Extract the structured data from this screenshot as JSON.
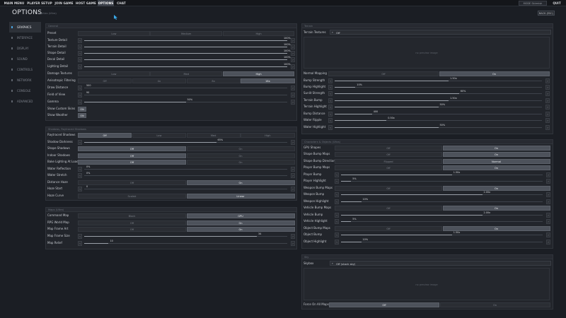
{
  "nav": {
    "items": [
      "MAIN MENU",
      "PLAYER SETUP",
      "JOIN GAME",
      "HOST GAME",
      "OPTIONS",
      "CHAT"
    ],
    "active": "OPTIONS",
    "mode": "MODE  Skirmish",
    "quit": "QUIT"
  },
  "header": {
    "title": "OPTIONS",
    "subtitle": "Graphics (Ultra)",
    "back": "BACK (ESC)"
  },
  "sidebar": {
    "items": [
      "GRAPHICS",
      "INTERFACE",
      "DISPLAY",
      "SOUND",
      "CONTROLS",
      "NETWORK",
      "CONSOLE",
      "ADVANCED"
    ],
    "active": "GRAPHICS"
  },
  "panels": {
    "general": "General",
    "shadows": "Shadows, Raytraced Shadows",
    "maps": "Maps (Ultra)",
    "terrain": "Terrain",
    "bumpmaps": "Characters & Objects (Ultra)",
    "sky": "Sky"
  },
  "general": {
    "preset": {
      "label": "Preset",
      "options": [
        "Low",
        "Medium",
        "High"
      ],
      "selected": -1
    },
    "texture_detail": {
      "label": "Texture Detail",
      "value": "100%",
      "level": 1.0
    },
    "terrain_detail": {
      "label": "Terrain Detail",
      "value": "100%",
      "level": 1.0
    },
    "shape_detail": {
      "label": "Shape Detail",
      "value": "100%",
      "level": 1.0
    },
    "decal_detail": {
      "label": "Decal Detail",
      "value": "100%",
      "level": 1.0
    },
    "lighting_detail": {
      "label": "Lighting Detail",
      "value": "100%",
      "level": 1.0
    },
    "damage_textures": {
      "label": "Damage Textures",
      "options": [
        "Low",
        "Med",
        "High"
      ],
      "selected": 2
    },
    "anisotropic": {
      "label": "Anisotropic Filtering",
      "options": [
        "Off",
        "4x",
        "8x",
        "16x"
      ],
      "selected": 3
    },
    "draw_distance": {
      "label": "Draw Distance",
      "value": "500",
      "level": 0.0
    },
    "field_of_view": {
      "label": "Field of View",
      "value": "90",
      "level": 0.0
    },
    "gamma": {
      "label": "Gamma",
      "value": "50%",
      "level": 0.5
    },
    "show_custom_skins": {
      "label": "Show Custom Skins",
      "value": "ON"
    },
    "show_weather": {
      "label": "Show Weather",
      "value": "ON"
    }
  },
  "shadows": {
    "raytraced": {
      "label": "Raytraced Shadows",
      "options": [
        "Off",
        "Low",
        "Med",
        "High"
      ],
      "selected": 0
    },
    "darkness": {
      "label": "Shadow Darkness",
      "value": "65%",
      "level": 0.65
    },
    "shape_shadows": {
      "label": "Shape Shadows",
      "options": [
        "Off",
        "On"
      ],
      "selected": 0
    },
    "indoor_shadows": {
      "label": "Indoor Shadows",
      "options": [
        "Off",
        "On"
      ],
      "selected": 0
    },
    "bake_lighting": {
      "label": "Bake Lighting At Load",
      "options": [
        "Off",
        "On"
      ],
      "selected": 0
    },
    "water_reflection": {
      "label": "Water Reflection",
      "value": "0%",
      "level": 0.0
    },
    "water_stretch": {
      "label": "Water Stretch",
      "value": "0%",
      "level": 0.0
    },
    "distance_haze": {
      "label": "Distance Haze",
      "options": [
        "Off",
        "On"
      ],
      "selected": 1
    },
    "haze_start": {
      "label": "Haze Start",
      "value": "0",
      "level": 0.0
    },
    "haze_curve": {
      "label": "Haze Curve",
      "options": [
        "Scaled",
        "Linear"
      ],
      "selected": 1
    }
  },
  "maps": {
    "command_map": {
      "label": "Command Map",
      "options": [
        "Block",
        "GPU"
      ],
      "selected": 1
    },
    "rpg_world_map": {
      "label": "RPG World Map",
      "options": [
        "Off",
        "On"
      ],
      "selected": 1
    },
    "map_frame_art": {
      "label": "Map Frame Art",
      "options": [
        "Off",
        "On"
      ],
      "selected": 1
    },
    "map_frame_size": {
      "label": "Map Frame Size",
      "value": "34",
      "level": 0.85
    },
    "map_relief": {
      "label": "Map Relief",
      "value": "10",
      "level": 0.12
    }
  },
  "terrain": {
    "textures": {
      "label": "Terrain Textures",
      "value": "Off"
    },
    "preview": "no preview image",
    "normal_mapping": {
      "label": "Normal Mapping",
      "options": [
        "Off",
        "On"
      ],
      "selected": 1
    },
    "bump_strength": {
      "label": "Bump Strength",
      "value": "1.50x",
      "level": 0.55
    },
    "bump_highlight": {
      "label": "Bump Highlight",
      "value": "10%",
      "level": 0.1
    },
    "sunlit_strength": {
      "label": "Sunlit Strength",
      "value": "60%",
      "level": 0.6
    },
    "terrain_bump": {
      "label": "Terrain Bump",
      "value": "1.50x",
      "level": 0.55
    },
    "terrain_highlight": {
      "label": "Terrain Highlight",
      "value": "50%",
      "level": 0.5
    },
    "bump_distance": {
      "label": "Bump Distance",
      "value": "400",
      "level": 0.18
    },
    "water_ripple": {
      "label": "Water Ripple",
      "value": "0.50x",
      "level": 0.25
    },
    "water_highlight": {
      "label": "Water Highlight",
      "value": "50%",
      "level": 0.5
    }
  },
  "bumpmaps": {
    "gpu_shapes": {
      "label": "GPU Shapes",
      "options": [
        "Off",
        "On"
      ],
      "selected": 1
    },
    "shape_bump_maps": {
      "label": "Shape Bump Maps",
      "options": [
        "Off",
        "On"
      ],
      "selected": 1
    },
    "shape_bump_direction": {
      "label": "Shape Bump Direction",
      "options": [
        "Flipped",
        "Normal"
      ],
      "selected": 1
    },
    "player_bump_maps": {
      "label": "Player Bump Maps",
      "options": [
        "Off",
        "On"
      ],
      "selected": 1
    },
    "player_bump": {
      "label": "Player Bump",
      "value": "1.50x",
      "level": 0.55
    },
    "player_highlight": {
      "label": "Player Highlight",
      "value": "5%",
      "level": 0.05
    },
    "weapon_bump_maps": {
      "label": "Weapon Bump Maps",
      "options": [
        "Off",
        "On"
      ],
      "selected": 1
    },
    "weapon_bump": {
      "label": "Weapon Bump",
      "value": "2.00x",
      "level": 0.7
    },
    "weapon_highlight": {
      "label": "Weapon Highlight",
      "value": "10%",
      "level": 0.1
    },
    "vehicle_bump_maps": {
      "label": "Vehicle Bump Maps",
      "options": [
        "Off",
        "On"
      ],
      "selected": 1
    },
    "vehicle_bump": {
      "label": "Vehicle Bump",
      "value": "2.00x",
      "level": 0.7
    },
    "vehicle_highlight": {
      "label": "Vehicle Highlight",
      "value": "5%",
      "level": 0.05
    },
    "object_bump_maps": {
      "label": "Object Bump Maps",
      "options": [
        "Off",
        "On"
      ],
      "selected": 1
    },
    "object_bump": {
      "label": "Object Bump",
      "value": "1.50x",
      "level": 0.55
    },
    "object_highlight": {
      "label": "Object Highlight",
      "value": "10%",
      "level": 0.1
    }
  },
  "sky": {
    "skybox": {
      "label": "Skybox",
      "value": "Off (stock sky)"
    },
    "preview": "no preview image",
    "force_on_all_maps": {
      "label": "Force On All Maps",
      "options": [
        "Off",
        "On"
      ],
      "selected": 0
    }
  },
  "colors": {
    "accent": "#4aa3df",
    "selected": "#4d525b",
    "panel": "#22252b"
  }
}
